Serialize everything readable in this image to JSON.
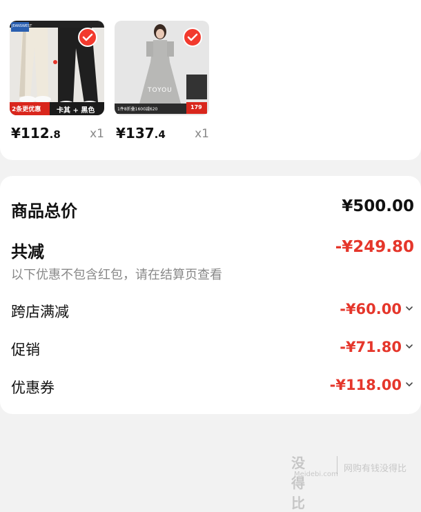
{
  "cart": {
    "items": [
      {
        "price_int": "¥112",
        "price_dec": ".8",
        "qty": "x1",
        "badge_text": "2条更优惠",
        "variant_text": "卡其 + 黑色",
        "brand_text": "JEANSWEST"
      },
      {
        "price_int": "¥137",
        "price_dec": ".4",
        "qty": "x1",
        "brand_text": "TOYOU",
        "tag_price": "179",
        "promo_text": "1件8折叠1600减620"
      }
    ]
  },
  "summary": {
    "total_label": "商品总价",
    "total_value": "¥500.00",
    "reduce_label": "共减",
    "reduce_value": "-¥249.80",
    "note": "以下优惠不包含红包，请在结算页查看",
    "details": [
      {
        "label": "跨店满减",
        "value": "-¥60.00"
      },
      {
        "label": "促销",
        "value": "-¥71.80"
      },
      {
        "label": "优惠券",
        "value": "-¥118.00"
      }
    ]
  },
  "watermark": {
    "main": "没得比",
    "sub": "Meidebi.com",
    "side": "网购有钱没得比"
  },
  "colors": {
    "accent": "#f23a2e",
    "discount": "#e5362b",
    "background": "#f2f2f2"
  },
  "icons": [
    "check-icon",
    "chevron-down-icon"
  ]
}
